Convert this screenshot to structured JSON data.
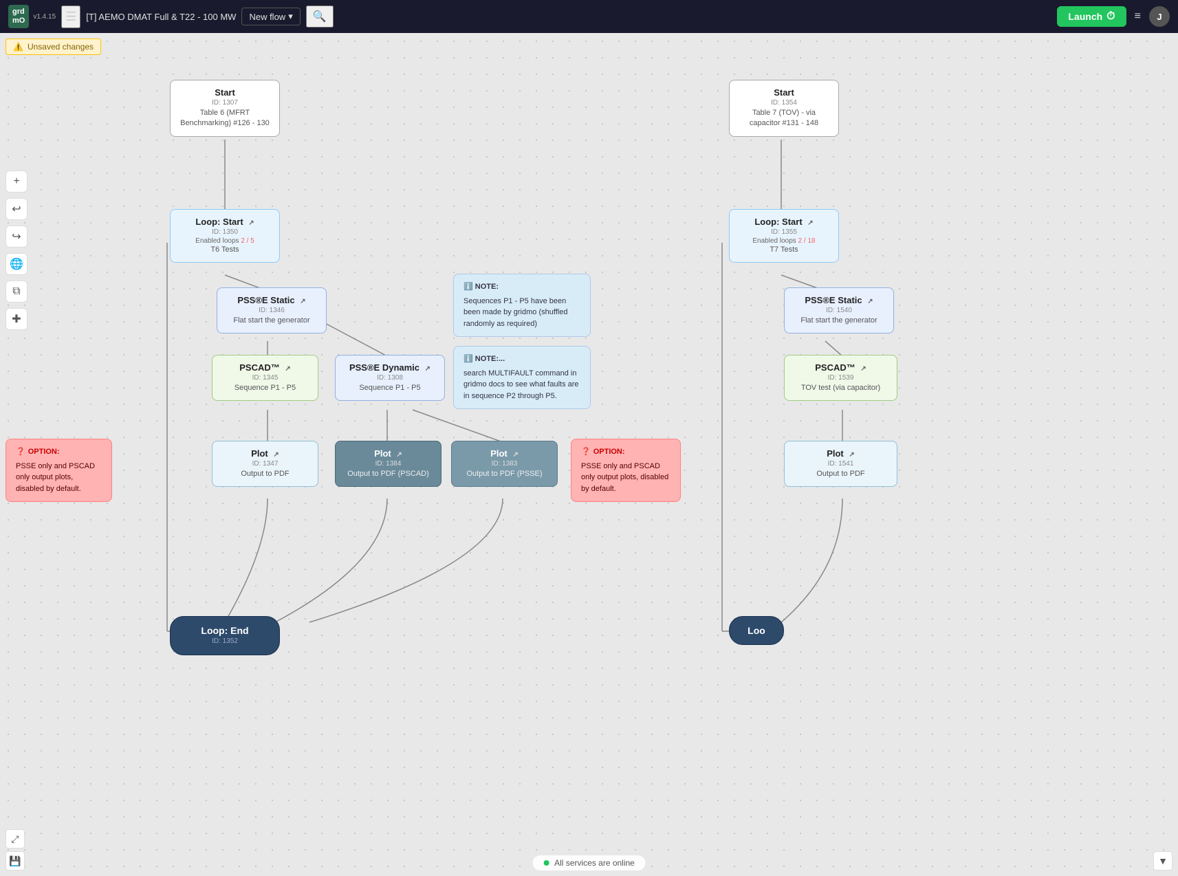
{
  "header": {
    "logo_line1": "grd",
    "logo_line2": "mO",
    "version": "v1.4.15",
    "breadcrumb": "[T] AEMO DMAT Full & T22 - 100 MW",
    "new_flow_label": "New flow",
    "launch_label": "Launch",
    "avatar_initials": "J"
  },
  "unsaved": "Unsaved changes",
  "status": "All services are online",
  "nodes": {
    "start1": {
      "title": "Start",
      "id": "ID: 1307",
      "detail": "Table 6 (MFRT Benchmarking) #126 - 130"
    },
    "start2": {
      "title": "Start",
      "id": "ID: 1354",
      "detail": "Table 7 (TOV) - via capacitor #131 - 148"
    },
    "loop_start1": {
      "title": "Loop: Start",
      "id": "ID: 1350",
      "loops_label": "Enabled loops",
      "loops_value": "2 / 5",
      "detail": "T6 Tests"
    },
    "loop_start2": {
      "title": "Loop: Start",
      "id": "ID: 1355",
      "loops_label": "Enabled loops",
      "loops_value": "2 / 18",
      "detail": "T7 Tests"
    },
    "psse_static1": {
      "title": "PSS®E Static",
      "id": "ID: 1346",
      "detail": "Flat start the generator"
    },
    "psse_static2": {
      "title": "PSS®E Static",
      "id": "ID: 1540",
      "detail": "Flat start the generator"
    },
    "pscad1": {
      "title": "PSCAD™",
      "id": "ID: 1345",
      "detail": "Sequence P1 - P5"
    },
    "psse_dynamic": {
      "title": "PSS®E Dynamic",
      "id": "ID: 1308",
      "detail": "Sequence P1 - P5"
    },
    "pscad2": {
      "title": "PSCAD™",
      "id": "ID: 1539",
      "detail": "TOV test (via capacitor)"
    },
    "plot1": {
      "title": "Plot",
      "id": "ID: 1347",
      "detail": "Output to PDF"
    },
    "plot2": {
      "title": "Plot",
      "id": "ID: 1384",
      "detail": "Output to PDF (PSCAD)"
    },
    "plot3": {
      "title": "Plot",
      "id": "ID: 1383",
      "detail": "Output to PDF (PSSE)"
    },
    "plot4": {
      "title": "Plot",
      "id": "ID: 1541",
      "detail": "Output to PDF"
    },
    "loop_end1": {
      "title": "Loop: End",
      "id": "ID: 1352"
    },
    "loop_end2_label": "Loo"
  },
  "notes": {
    "note1": {
      "header": "NOTE:",
      "body": "Sequences P1 - P5 have been been made by gridmo (shuffled randomly as required)"
    },
    "note2": {
      "header": "NOTE:...",
      "body": "search MULTIFAULT command in gridmo docs to see what faults are in sequence P2 through P5."
    }
  },
  "options": {
    "opt1": {
      "header": "OPTION:",
      "body": "PSSE only and PSCAD only output plots, disabled by default."
    },
    "opt2": {
      "header": "OPTION:",
      "body": "PSSE only and PSCAD only output plots, disabled by default."
    }
  },
  "toolbar": {
    "zoom_in": "+",
    "undo": "↩",
    "redo": "↪",
    "globe": "🌐",
    "layers": "⧉",
    "plus_node": "✚"
  }
}
